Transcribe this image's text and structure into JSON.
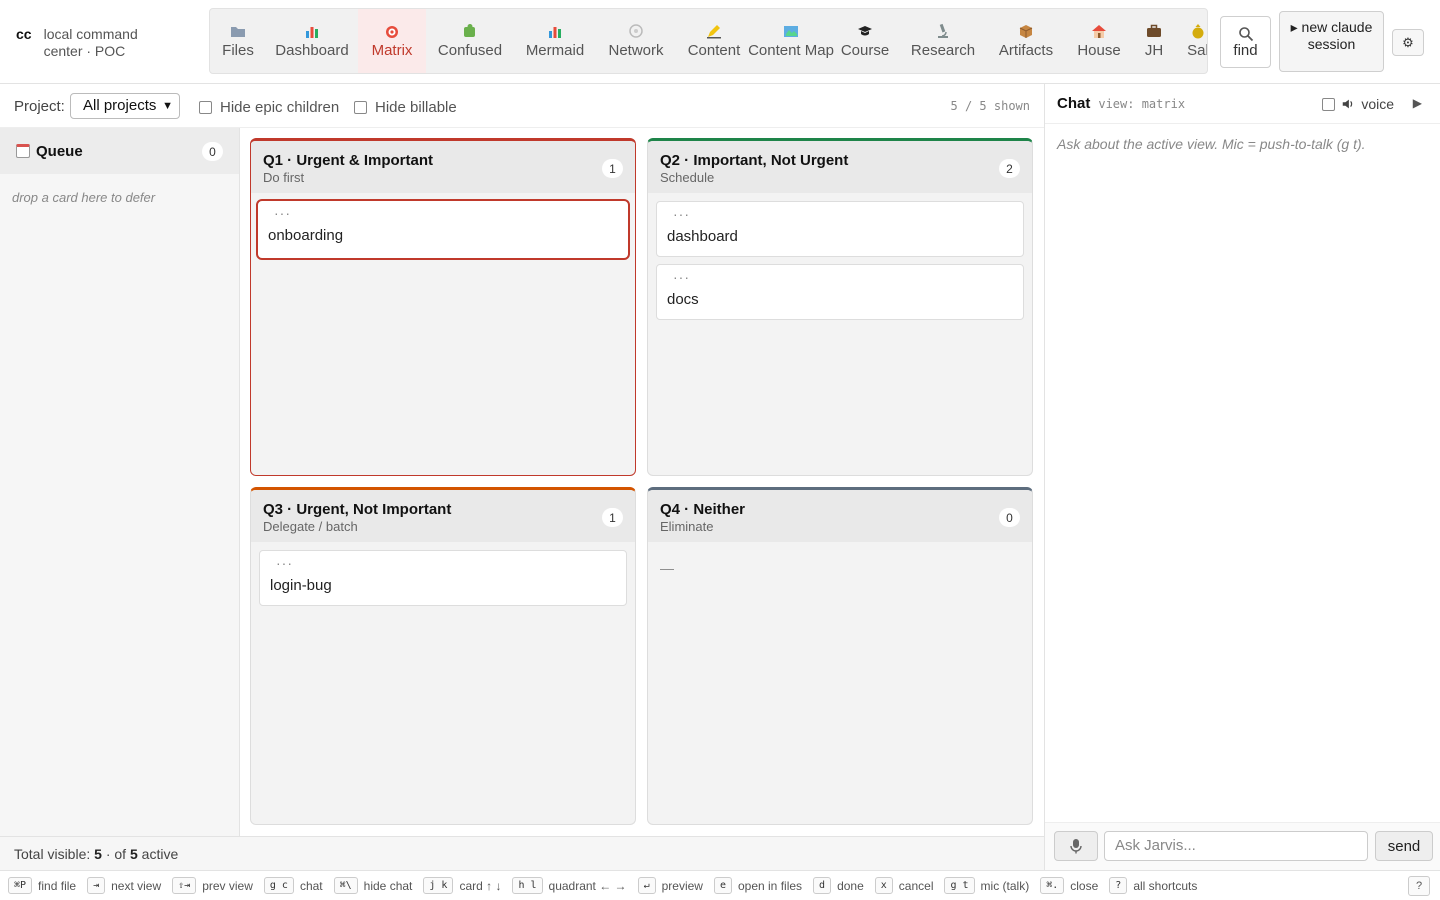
{
  "brand": {
    "short": "cc",
    "name": "local command center · POC"
  },
  "nav": {
    "items": [
      {
        "label": "Files",
        "icon": "folder-icon"
      },
      {
        "label": "Dashboard",
        "icon": "bar-chart-icon"
      },
      {
        "label": "Matrix",
        "icon": "target-icon",
        "active": true
      },
      {
        "label": "Confused",
        "icon": "puzzle-icon"
      },
      {
        "label": "Mermaid",
        "icon": "bar-chart-icon"
      },
      {
        "label": "Network",
        "icon": "network-icon"
      },
      {
        "label": "Content",
        "icon": "pencil-icon"
      },
      {
        "label": "Content Map",
        "icon": "map-icon"
      },
      {
        "label": "Course",
        "icon": "graduation-cap-icon"
      },
      {
        "label": "Research",
        "icon": "microscope-icon"
      },
      {
        "label": "Artifacts",
        "icon": "package-icon"
      },
      {
        "label": "House",
        "icon": "house-icon"
      },
      {
        "label": "JH",
        "icon": "briefcase-icon"
      },
      {
        "label": "Sal",
        "icon": "money-bag-icon"
      }
    ]
  },
  "actions": {
    "find": "find",
    "new_session": "▸ new claude session",
    "settings_icon": "gear-icon"
  },
  "toolbar": {
    "project_label": "Project:",
    "project_value": "All projects",
    "hide_epic_children": "Hide epic children",
    "hide_billable": "Hide billable",
    "shown": "5 / 5 shown"
  },
  "queue": {
    "title": "Queue",
    "count": "0",
    "hint": "drop a card here to defer"
  },
  "quadrants": [
    {
      "title": "Q1 · Urgent & Important",
      "subtitle": "Do first",
      "count": "1",
      "color": "#c0392b",
      "cards": [
        "onboarding"
      ]
    },
    {
      "title": "Q2 · Important, Not Urgent",
      "subtitle": "Schedule",
      "count": "2",
      "color": "#1e8449",
      "cards": [
        "dashboard",
        "docs"
      ]
    },
    {
      "title": "Q3 · Urgent, Not Important",
      "subtitle": "Delegate / batch",
      "count": "1",
      "color": "#d35400",
      "cards": [
        "login-bug"
      ]
    },
    {
      "title": "Q4 · Neither",
      "subtitle": "Eliminate",
      "count": "0",
      "color": "#5d6d7e",
      "cards": [],
      "empty": "—"
    }
  ],
  "card_menu": "···",
  "total": {
    "prefix": "Total visible:",
    "visible": "5",
    "mid": "· of",
    "active": "5",
    "suffix": "active"
  },
  "chat": {
    "title": "Chat",
    "view": "view: matrix",
    "voice": "voice",
    "play": "▶",
    "hint": "Ask about the active view. Mic = push-to-talk (g t).",
    "placeholder": "Ask Jarvis...",
    "send": "send"
  },
  "shortcuts": [
    {
      "key": "⌘P",
      "label": "find file"
    },
    {
      "key": "⇥",
      "label": "next view"
    },
    {
      "key": "⇧⇥",
      "label": "prev view"
    },
    {
      "key": "g c",
      "label": "chat"
    },
    {
      "key": "⌘\\",
      "label": "hide chat"
    },
    {
      "key": "j k",
      "label": "card ↑ ↓"
    },
    {
      "key": "h l",
      "label": "quadrant ← →"
    },
    {
      "key": "↵",
      "label": "preview"
    },
    {
      "key": "e",
      "label": "open in files"
    },
    {
      "key": "d",
      "label": "done"
    },
    {
      "key": "x",
      "label": "cancel"
    },
    {
      "key": "g t",
      "label": "mic (talk)"
    },
    {
      "key": "⌘.",
      "label": "close"
    },
    {
      "key": "?",
      "label": "all shortcuts"
    }
  ],
  "help": "?"
}
